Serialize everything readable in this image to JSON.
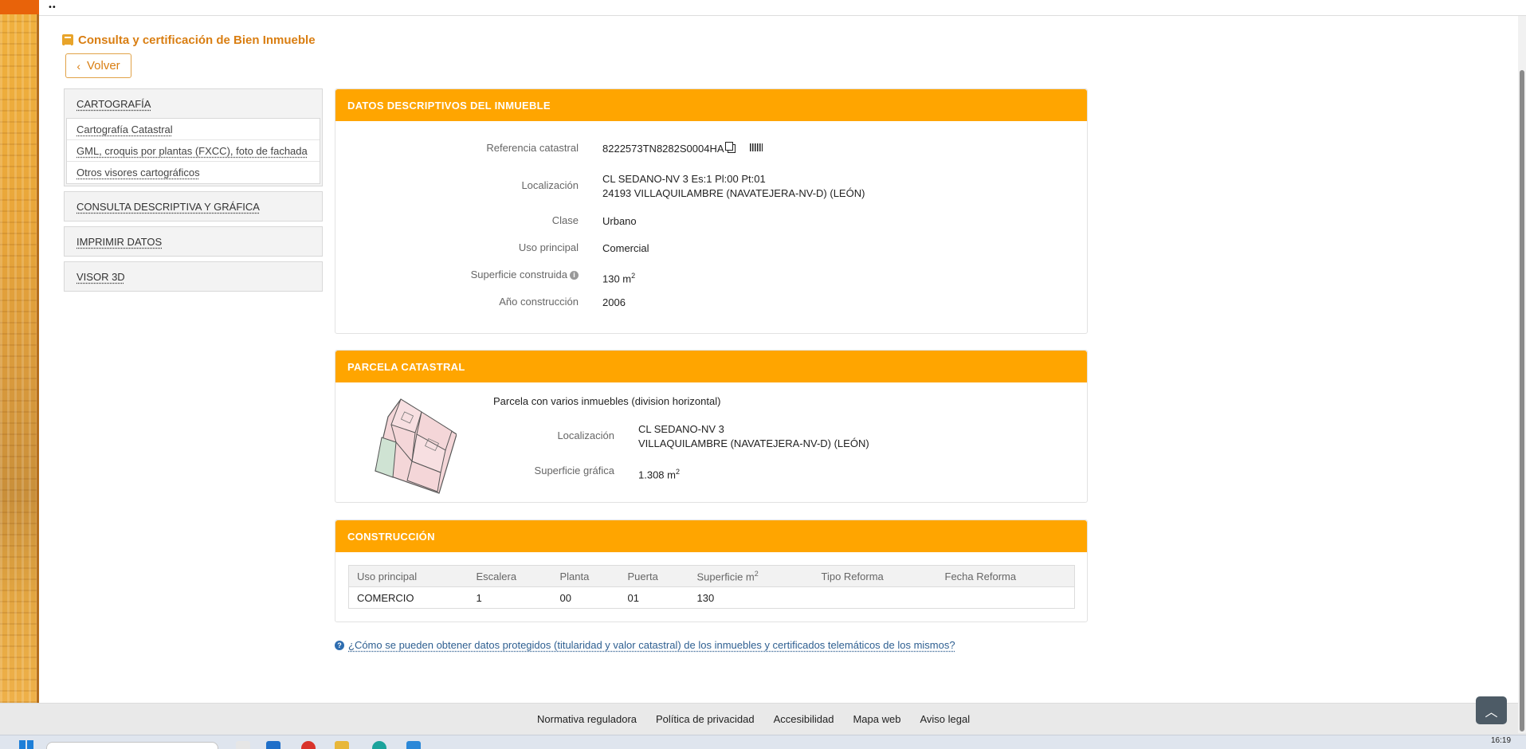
{
  "topbar": {
    "dots": "••"
  },
  "page": {
    "title": "Consulta y certificación de Bien Inmueble",
    "back_label": "Volver"
  },
  "left_menu": {
    "cartografia": {
      "label": "CARTOGRAFÍA",
      "items": [
        "Cartografía Catastral",
        "GML, croquis por plantas (FXCC), foto de fachada",
        "Otros visores cartográficos"
      ]
    },
    "consulta": "CONSULTA DESCRIPTIVA Y GRÁFICA",
    "imprimir": "IMPRIMIR DATOS",
    "visor": "VISOR 3D"
  },
  "datos": {
    "heading": "DATOS DESCRIPTIVOS DEL INMUEBLE",
    "ref_label": "Referencia catastral",
    "ref_value": "8222573TN8282S0004HA",
    "loc_label": "Localización",
    "loc_line1": "CL SEDANO-NV 3 Es:1 Pl:00 Pt:01",
    "loc_line2": "24193 VILLAQUILAMBRE (NAVATEJERA-NV-D) (LEÓN)",
    "clase_label": "Clase",
    "clase_value": "Urbano",
    "uso_label": "Uso principal",
    "uso_value": "Comercial",
    "sup_label": "Superficie construida",
    "sup_value": "130 m",
    "sup_unit_sup": "2",
    "anio_label": "Año construcción",
    "anio_value": "2006"
  },
  "parcela": {
    "heading": "PARCELA CATASTRAL",
    "desc": "Parcela con varios inmuebles (division horizontal)",
    "loc_label": "Localización",
    "loc_line1": "CL SEDANO-NV 3",
    "loc_line2": "VILLAQUILAMBRE (NAVATEJERA-NV-D) (LEÓN)",
    "sup_label": "Superficie gráfica",
    "sup_value": "1.308 m",
    "sup_unit_sup": "2"
  },
  "construccion": {
    "heading": "CONSTRUCCIÓN",
    "columns": [
      "Uso principal",
      "Escalera",
      "Planta",
      "Puerta",
      "Superficie m",
      "Tipo Reforma",
      "Fecha Reforma"
    ],
    "sup_col_sup": "2",
    "rows": [
      [
        "COMERCIO",
        "1",
        "00",
        "01",
        "130",
        "",
        ""
      ]
    ]
  },
  "help_link": "¿Cómo se pueden obtener datos protegidos (titularidad y valor catastral) de los inmuebles y certificados telemáticos de los mismos?",
  "footer": {
    "links": [
      "Normativa reguladora",
      "Política de privacidad",
      "Accesibilidad",
      "Mapa web",
      "Aviso legal"
    ]
  },
  "taskbar": {
    "time": "16:19"
  },
  "colors": {
    "accent": "#ffa500",
    "title_orange": "#d97e12",
    "link_blue": "#2e5f91"
  }
}
